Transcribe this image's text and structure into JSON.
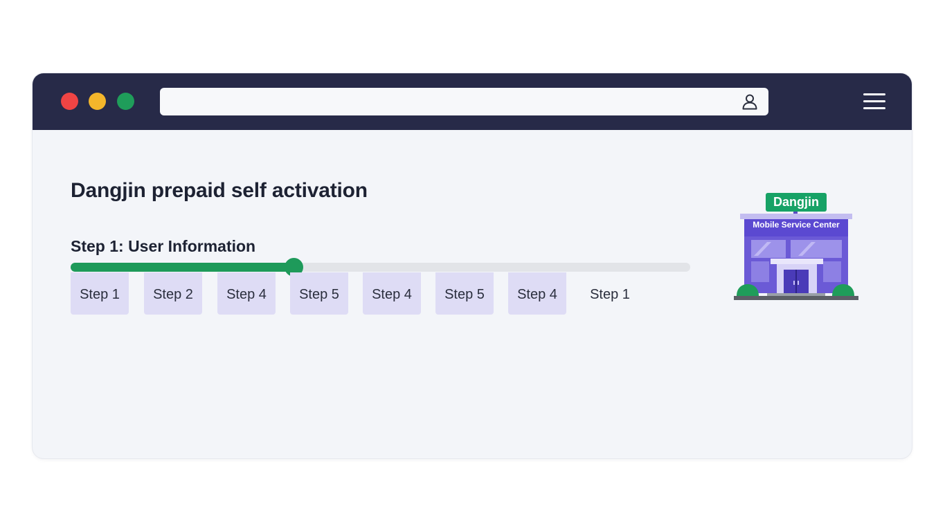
{
  "browser": {
    "traffic_lights": {
      "close": "#ef4444",
      "minimize": "#f4b62b",
      "maximize": "#1f9d5a"
    },
    "address_bar": {
      "value": "",
      "icon": "user-icon"
    },
    "menu_icon": "hamburger-menu-icon",
    "titlebar_color": "#272a48"
  },
  "page": {
    "title": "Dangjin prepaid self activation",
    "current_step_title": "Step 1: User Information"
  },
  "progress": {
    "value_percent": 36,
    "fill_color": "#1e9a5a",
    "track_color": "#e2e4e8"
  },
  "steps": [
    {
      "label": "Step 1",
      "highlighted": true
    },
    {
      "label": "Step 2",
      "highlighted": true
    },
    {
      "label": "Step 4",
      "highlighted": true
    },
    {
      "label": "Step 5",
      "highlighted": true
    },
    {
      "label": "Step 4",
      "highlighted": true
    },
    {
      "label": "Step 5",
      "highlighted": true
    },
    {
      "label": "Step 4",
      "highlighted": true
    },
    {
      "label": "Step 1",
      "highlighted": false
    }
  ],
  "illustration": {
    "sign": "Dangjin",
    "building_label": "Mobile Service Center",
    "building_color": "#6b5ad6",
    "sign_color": "#17a266"
  }
}
